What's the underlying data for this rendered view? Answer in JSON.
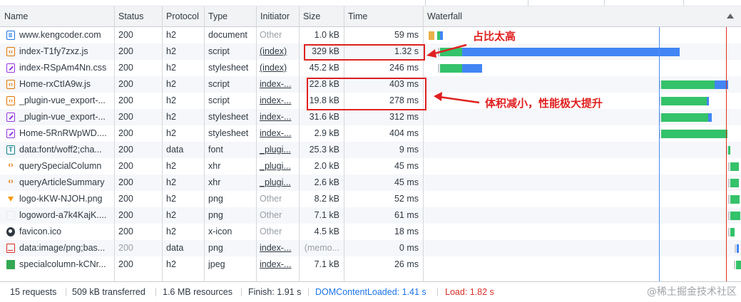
{
  "columns": {
    "name": "Name",
    "status": "Status",
    "protocol": "Protocol",
    "type": "Type",
    "initiator": "Initiator",
    "size": "Size",
    "time": "Time",
    "waterfall": "Waterfall"
  },
  "rows": [
    {
      "icon": "document-icon",
      "name": "www.kengcoder.com",
      "status": "200",
      "protocol": "h2",
      "type": "document",
      "initiator": "Other",
      "size": "1.0 kB",
      "time": "59 ms"
    },
    {
      "icon": "script-icon",
      "name": "index-T1fy7zxz.js",
      "status": "200",
      "protocol": "h2",
      "type": "script",
      "initiator": "(index)",
      "size": "329 kB",
      "time": "1.32 s"
    },
    {
      "icon": "stylesheet-icon",
      "name": "index-RSpAm4Nn.css",
      "status": "200",
      "protocol": "h2",
      "type": "stylesheet",
      "initiator": "(index)",
      "size": "45.2 kB",
      "time": "246 ms"
    },
    {
      "icon": "script-icon",
      "name": "Home-rxCtIA9w.js",
      "status": "200",
      "protocol": "h2",
      "type": "script",
      "initiator": "index-...",
      "size": "22.8 kB",
      "time": "403 ms"
    },
    {
      "icon": "script-icon",
      "name": "_plugin-vue_export-...",
      "status": "200",
      "protocol": "h2",
      "type": "script",
      "initiator": "index-...",
      "size": "19.8 kB",
      "time": "278 ms"
    },
    {
      "icon": "stylesheet-icon",
      "name": "_plugin-vue_export-...",
      "status": "200",
      "protocol": "h2",
      "type": "stylesheet",
      "initiator": "index-...",
      "size": "31.6 kB",
      "time": "312 ms"
    },
    {
      "icon": "stylesheet-icon",
      "name": "Home-5RnRWpWD....",
      "status": "200",
      "protocol": "h2",
      "type": "stylesheet",
      "initiator": "index-...",
      "size": "2.9 kB",
      "time": "404 ms"
    },
    {
      "icon": "font-icon",
      "name": "data:font/woff2;cha...",
      "status": "200",
      "protocol": "data",
      "type": "font",
      "initiator": "_plugi...",
      "size": "25.3 kB",
      "time": "9 ms"
    },
    {
      "icon": "xhr-icon",
      "name": "querySpecialColumn",
      "status": "200",
      "protocol": "h2",
      "type": "xhr",
      "initiator": "_plugi...",
      "size": "2.0 kB",
      "time": "45 ms"
    },
    {
      "icon": "xhr-icon",
      "name": "queryArticleSummary",
      "status": "200",
      "protocol": "h2",
      "type": "xhr",
      "initiator": "_plugi...",
      "size": "2.6 kB",
      "time": "45 ms"
    },
    {
      "icon": "png-icon",
      "name": "logo-kKW-NJOH.png",
      "status": "200",
      "protocol": "h2",
      "type": "png",
      "initiator": "Other",
      "size": "8.2 kB",
      "time": "52 ms"
    },
    {
      "icon": "png-icon-light",
      "name": "logoword-a7k4KajK....",
      "status": "200",
      "protocol": "h2",
      "type": "png",
      "initiator": "Other",
      "size": "7.1 kB",
      "time": "61 ms"
    },
    {
      "icon": "favicon-icon",
      "name": "favicon.ico",
      "status": "200",
      "protocol": "h2",
      "type": "x-icon",
      "initiator": "Other",
      "size": "4.5 kB",
      "time": "18 ms"
    },
    {
      "icon": "image-icon",
      "name": "data:image/png;bas...",
      "status": "200",
      "protocol": "data",
      "type": "png",
      "initiator": "index-...",
      "size": "(memo...",
      "time": "0 ms"
    },
    {
      "icon": "jpeg-icon",
      "name": "specialcolumn-kCNr...",
      "status": "200",
      "protocol": "h2",
      "type": "jpeg",
      "initiator": "index-...",
      "size": "7.1 kB",
      "time": "26 ms"
    }
  ],
  "annotations": {
    "main_js_note": "占比太高",
    "chunks_note": "体积减小，性能极大提升"
  },
  "footer": {
    "requests": "15 requests",
    "transferred": "509 kB transferred",
    "resources": "1.6 MB resources",
    "finish": "Finish: 1.91 s",
    "dcl": "DOMContentLoaded: 1.41 s",
    "load": "Load: 1.82 s"
  },
  "watermark": "@稀土掘金技术社区",
  "colors": {
    "waiting": "#34c26a",
    "download": "#4285f4",
    "dcl_line": "#4a8cf7",
    "load_line": "#d93025",
    "annotation": "#e02020"
  }
}
